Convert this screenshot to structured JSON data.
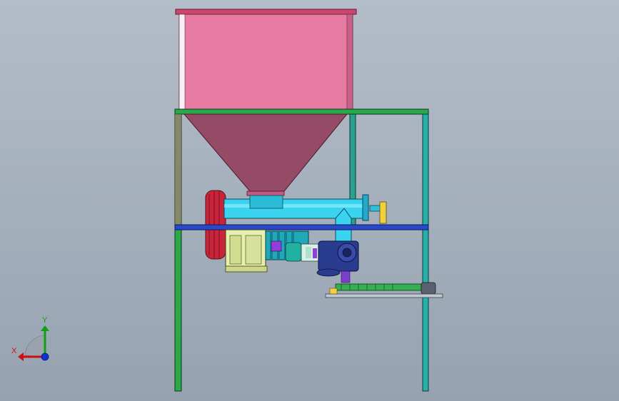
{
  "view": {
    "background_top": "#b3bdc8",
    "background_bottom": "#96a2b0"
  },
  "triad": {
    "x_label": "X",
    "y_label": "Y",
    "x_color": "#cc1010",
    "y_color": "#10a010",
    "z_color": "#1030d0"
  },
  "model": {
    "hopper_color": "#e67aa1",
    "cone_color": "#954a65",
    "frame_green": "#2aa84a",
    "frame_cyan": "#25b0a8",
    "beam_blue": "#2848c8",
    "screw_tube_color": "#3ad4f0",
    "fan_color": "#c8243a",
    "gearbox_color": "#e6efb0",
    "motor_color": "#1ea8b8",
    "reducer_color": "#2a3c90"
  }
}
